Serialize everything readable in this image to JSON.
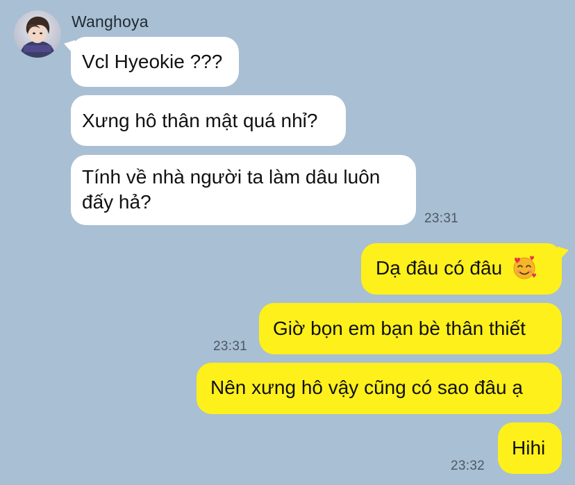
{
  "sender": {
    "name": "Wanghoya"
  },
  "incoming": [
    {
      "lines": [
        "Vcl Hyeokie ???"
      ]
    },
    {
      "lines": [
        "Xưng hô thân mật quá nhỉ?"
      ]
    },
    {
      "lines": [
        "Tính về nhà người ta làm dâu luôn",
        "đấy hả?"
      ]
    }
  ],
  "incoming_time": "23:31",
  "outgoing": [
    {
      "text": "Dạ đâu có đâu",
      "emoji": "smiling-face-with-hearts-icon"
    },
    {
      "text": "Giờ bọn em bạn bè thân thiết"
    },
    {
      "text": "Nên xưng hô vậy cũng có sao đâu ạ"
    },
    {
      "text": "Hihi"
    }
  ],
  "outgoing_times": [
    "23:31",
    "23:32"
  ],
  "colors": {
    "background": "#a9bfd3",
    "incoming_bubble": "#ffffff",
    "outgoing_bubble": "#fef01b",
    "timestamp": "#4c5863"
  }
}
